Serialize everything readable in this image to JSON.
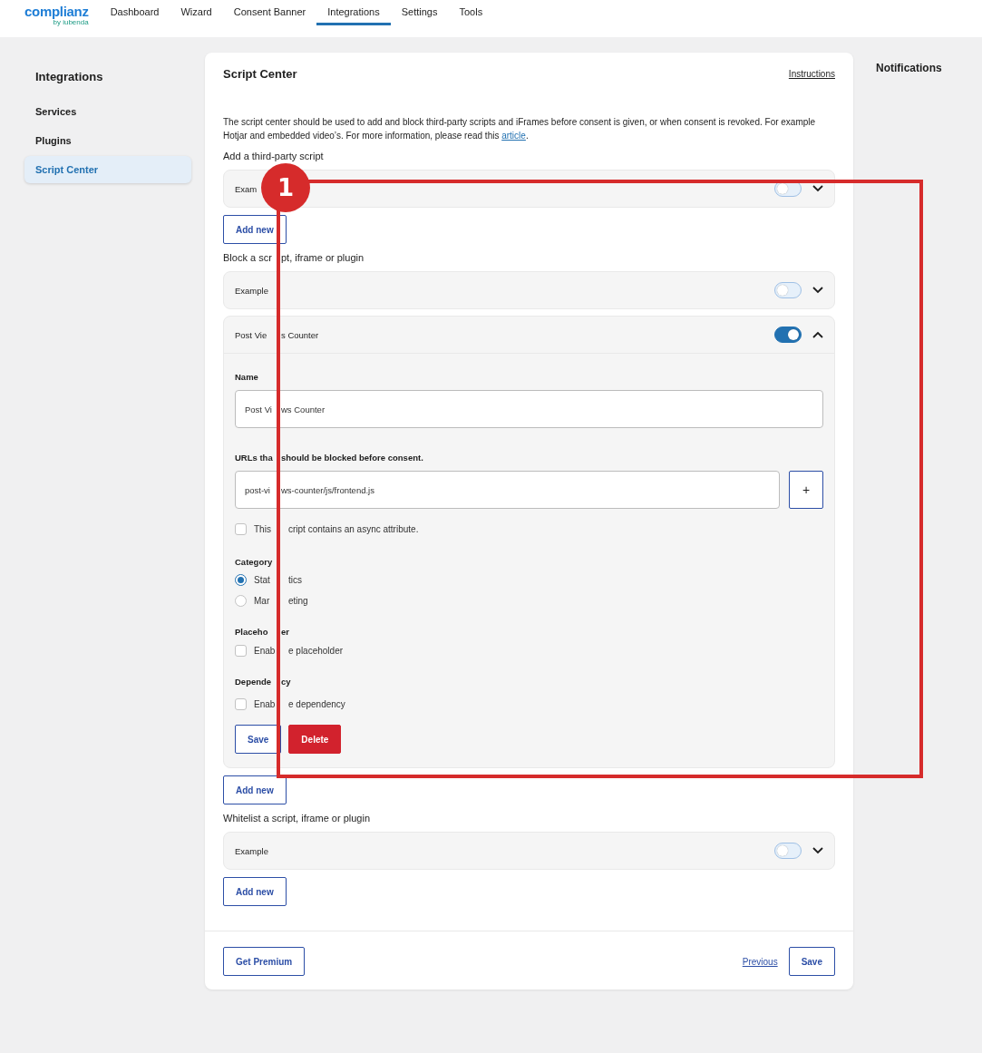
{
  "nav": {
    "logo": "complianz",
    "logo_sub": "by iubenda",
    "tabs": [
      {
        "label": "Dashboard",
        "selected": false
      },
      {
        "label": "Wizard",
        "selected": false
      },
      {
        "label": "Consent Banner",
        "selected": false
      },
      {
        "label": "Integrations",
        "selected": true
      },
      {
        "label": "Settings",
        "selected": false
      },
      {
        "label": "Tools",
        "selected": false
      }
    ]
  },
  "sidebar": {
    "title": "Integrations",
    "items": [
      {
        "label": "Services",
        "selected": false
      },
      {
        "label": "Plugins",
        "selected": false
      },
      {
        "label": "Script Center",
        "selected": true
      }
    ]
  },
  "main": {
    "title": "Script Center",
    "instructions_link": "Instructions",
    "description": "The script center should be used to add and block third-party scripts and iFrames before consent is given, or when consent is revoked. For example Hotjar and embedded video’s. For more information, please read this",
    "description_link": "article",
    "description_end": ".",
    "sections": [
      {
        "title": "Add a third-party script",
        "add_button": "Add new",
        "items": [
          {
            "name": "Exam",
            "on": false,
            "expanded": false
          }
        ]
      },
      {
        "title": [
          "Block a scr",
          "pt, iframe or plugin"
        ],
        "add_button": "Add new",
        "items": [
          {
            "name": "Example",
            "on": false,
            "expanded": false
          },
          {
            "name": [
              "Post Vie",
              "s Counter"
            ],
            "on": true,
            "expanded": true,
            "form": {
              "name_label": "Name",
              "name_value": [
                "Post Vi",
                "ws Counter"
              ],
              "urls_label": [
                "URLs tha",
                "should be blocked before consent."
              ],
              "url_value": [
                "post-vi",
                "ws-counter/js/frontend.js"
              ],
              "add_url_button": "+",
              "async": {
                "label": [
                  "This",
                  "cript contains an async attribute."
                ],
                "checked": false
              },
              "category_label": "Category",
              "categories": [
                {
                  "label": [
                    "Stat",
                    "tics"
                  ],
                  "selected": true
                },
                {
                  "label": [
                    "Mar",
                    "eting"
                  ],
                  "selected": false
                }
              ],
              "placeholder_label": [
                "Placeho",
                "er"
              ],
              "placeholder": {
                "label": [
                  "Enab",
                  "e placeholder"
                ],
                "checked": false
              },
              "dependency_label": [
                "Depende",
                "cy"
              ],
              "dependency": {
                "label": [
                  "Enab",
                  "e dependency"
                ],
                "checked": false
              },
              "save_button": "Save",
              "delete_button": "Delete"
            }
          }
        ]
      },
      {
        "title": "Whitelist a script, iframe or plugin",
        "add_button": "Add new",
        "items": [
          {
            "name": "Example",
            "on": false,
            "expanded": false
          }
        ]
      }
    ],
    "footer": {
      "premium_button": "Get Premium",
      "previous_link": "Previous",
      "save_button": "Save"
    }
  },
  "notifications": {
    "title": "Notifications"
  },
  "annotation": {
    "number": "1"
  }
}
